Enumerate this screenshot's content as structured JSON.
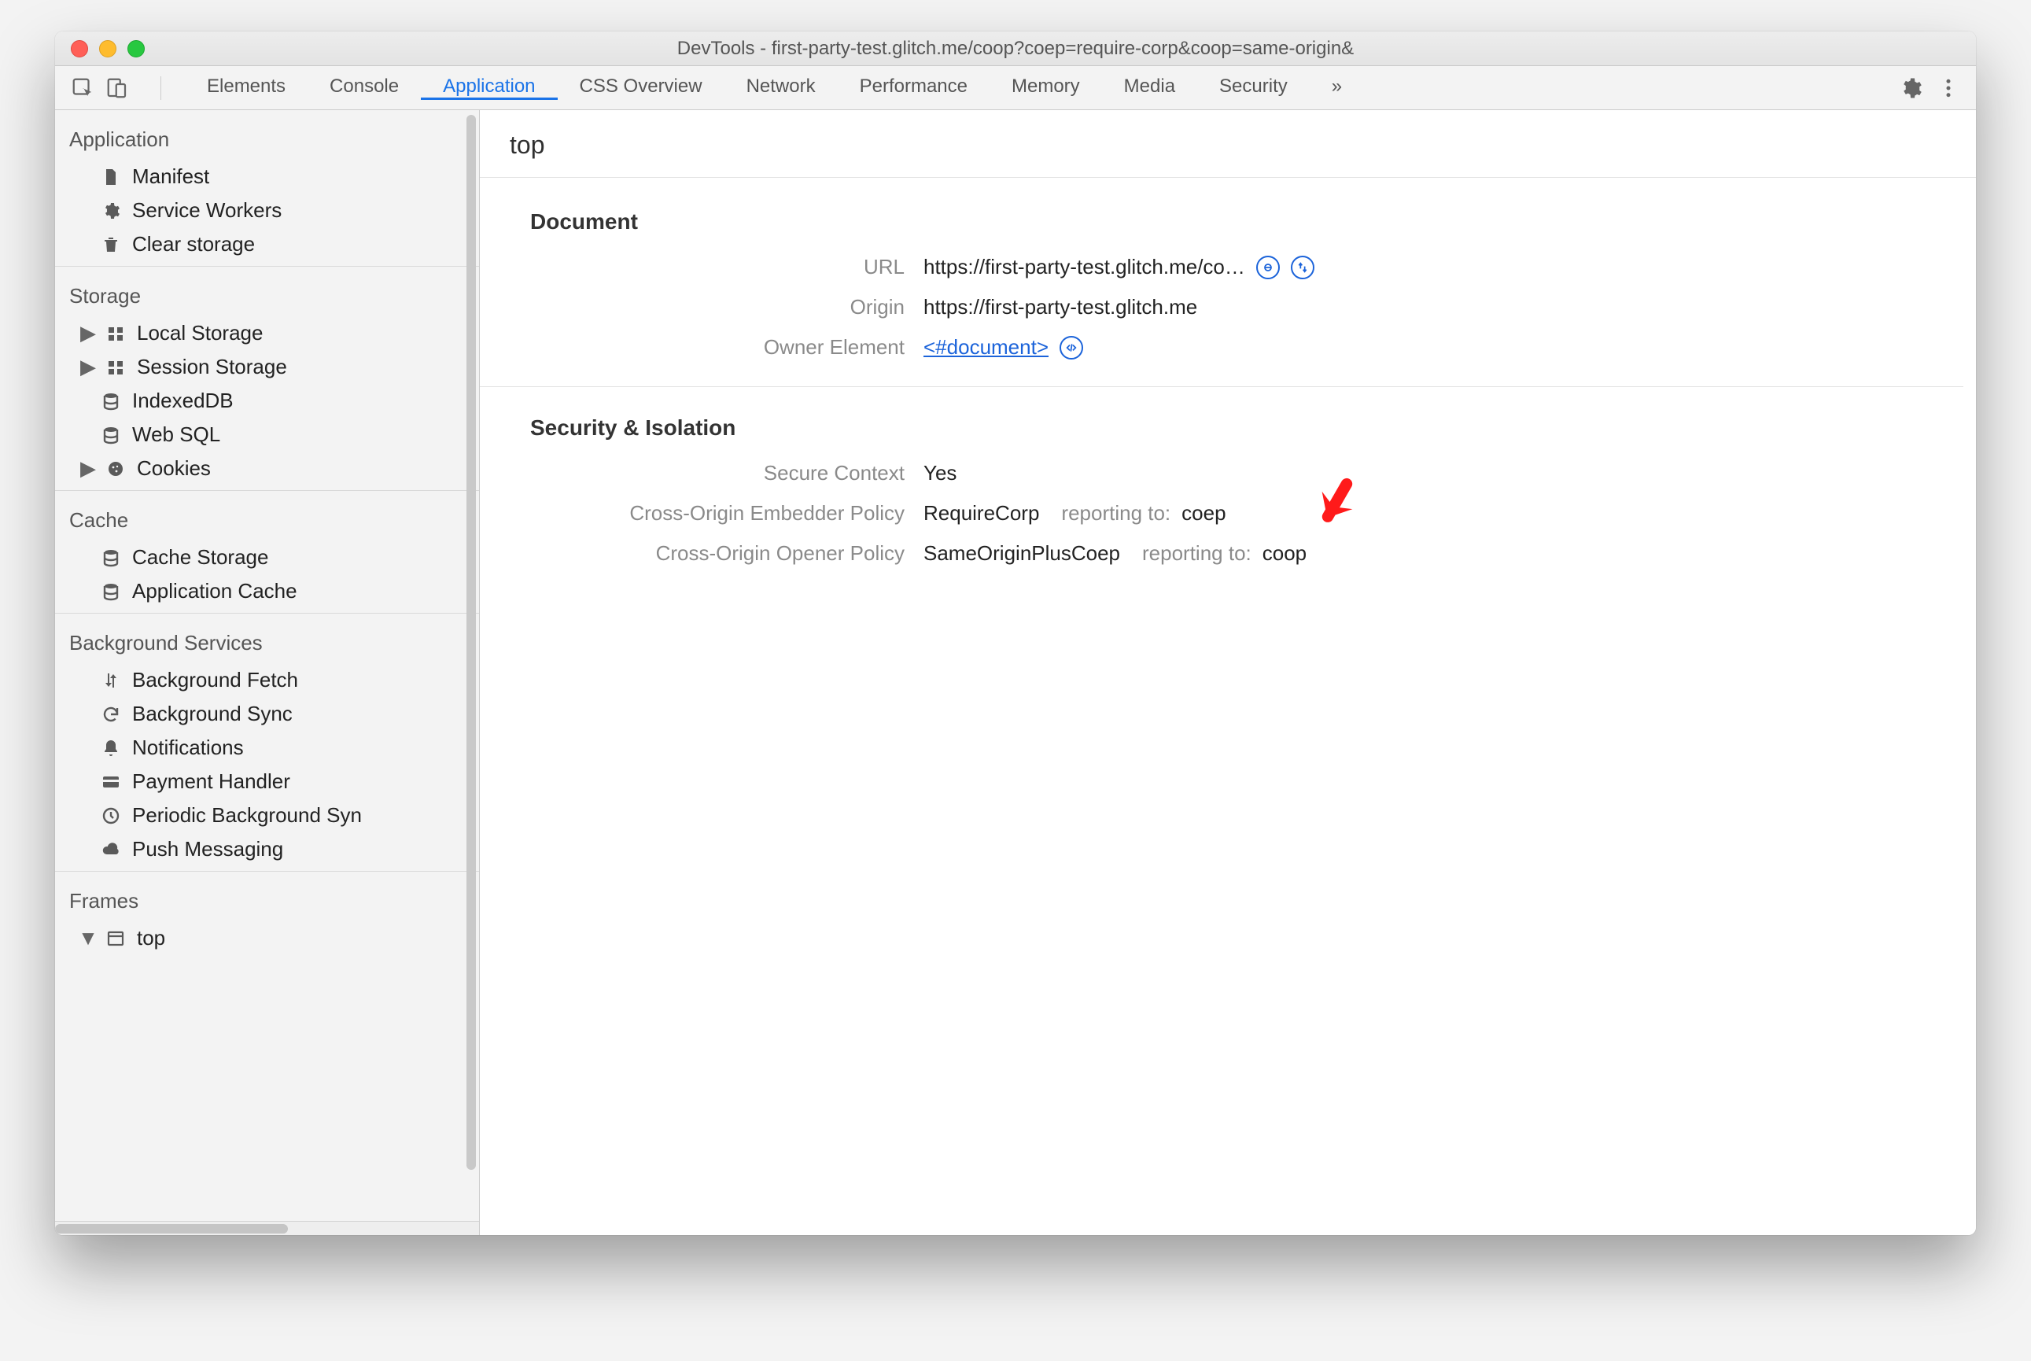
{
  "title": "DevTools - first-party-test.glitch.me/coop?coep=require-corp&coop=same-origin&",
  "tabs": {
    "left": [
      {
        "id": "elements",
        "label": "Elements"
      },
      {
        "id": "console",
        "label": "Console"
      },
      {
        "id": "application",
        "label": "Application",
        "active": true
      },
      {
        "id": "cssoverview",
        "label": "CSS Overview"
      },
      {
        "id": "network",
        "label": "Network"
      },
      {
        "id": "performance",
        "label": "Performance"
      },
      {
        "id": "memory",
        "label": "Memory"
      },
      {
        "id": "media",
        "label": "Media"
      },
      {
        "id": "security",
        "label": "Security"
      }
    ],
    "overflow": "»"
  },
  "sidebar": {
    "groups": [
      {
        "heading": "Application",
        "items": [
          {
            "id": "manifest",
            "label": "Manifest",
            "icon": "file-icon"
          },
          {
            "id": "sw",
            "label": "Service Workers",
            "icon": "gear-icon"
          },
          {
            "id": "clear",
            "label": "Clear storage",
            "icon": "trash-icon"
          }
        ]
      },
      {
        "heading": "Storage",
        "items": [
          {
            "id": "ls",
            "label": "Local Storage",
            "icon": "grid-icon",
            "caret": true
          },
          {
            "id": "ss",
            "label": "Session Storage",
            "icon": "grid-icon",
            "caret": true
          },
          {
            "id": "idb",
            "label": "IndexedDB",
            "icon": "db-icon"
          },
          {
            "id": "websql",
            "label": "Web SQL",
            "icon": "db-icon"
          },
          {
            "id": "cookies",
            "label": "Cookies",
            "icon": "cookie-icon",
            "caret": true
          }
        ]
      },
      {
        "heading": "Cache",
        "items": [
          {
            "id": "cs",
            "label": "Cache Storage",
            "icon": "db-icon"
          },
          {
            "id": "appcache",
            "label": "Application Cache",
            "icon": "db-icon"
          }
        ]
      },
      {
        "heading": "Background Services",
        "items": [
          {
            "id": "bgfetch",
            "label": "Background Fetch",
            "icon": "updown-icon"
          },
          {
            "id": "bgsync",
            "label": "Background Sync",
            "icon": "sync-icon"
          },
          {
            "id": "notif",
            "label": "Notifications",
            "icon": "bell-icon"
          },
          {
            "id": "pay",
            "label": "Payment Handler",
            "icon": "card-icon"
          },
          {
            "id": "periodic",
            "label": "Periodic Background Syn",
            "icon": "clock-icon"
          },
          {
            "id": "push",
            "label": "Push Messaging",
            "icon": "cloud-icon"
          }
        ]
      },
      {
        "heading": "Frames",
        "items": [
          {
            "id": "frame-top",
            "label": "top",
            "icon": "window-icon",
            "caret": true,
            "caretOpen": true,
            "selected": false
          }
        ]
      }
    ]
  },
  "main": {
    "header": "top",
    "document": {
      "title": "Document",
      "url_label": "URL",
      "url_value": "https://first-party-test.glitch.me/co…",
      "origin_label": "Origin",
      "origin_value": "https://first-party-test.glitch.me",
      "owner_label": "Owner Element",
      "owner_link_text": "<#document>"
    },
    "security": {
      "title": "Security & Isolation",
      "sc_label": "Secure Context",
      "sc_value": "Yes",
      "coep_label": "Cross-Origin Embedder Policy",
      "coep_value": "RequireCorp",
      "coep_reporting_label": "reporting to:",
      "coep_reporting_value": "coep",
      "coop_label": "Cross-Origin Opener Policy",
      "coop_value": "SameOriginPlusCoep",
      "coop_reporting_label": "reporting to:",
      "coop_reporting_value": "coop"
    }
  }
}
